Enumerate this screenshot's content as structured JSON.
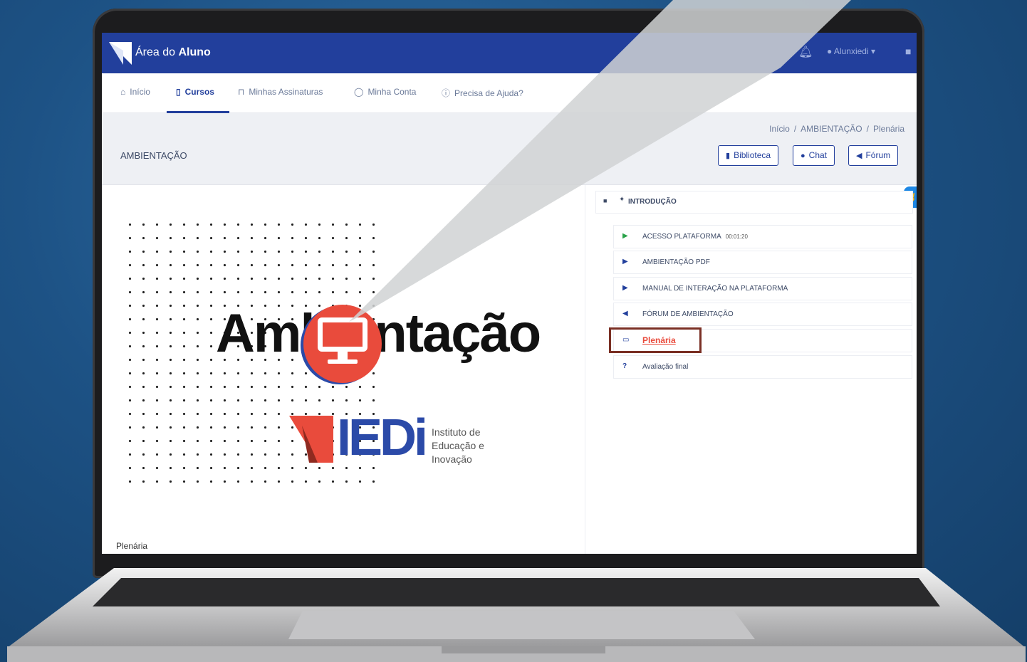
{
  "header": {
    "app_title_prefix": "Área do",
    "app_title_bold": "Aluno",
    "user_name": "Alunxiedi",
    "brand_color": "#223f9c"
  },
  "nav": {
    "items": [
      {
        "label": "Início",
        "icon": "home-icon"
      },
      {
        "label": "Cursos",
        "icon": "book-icon",
        "active": true
      },
      {
        "label": "Minhas Assinaturas",
        "icon": "cart-icon"
      },
      {
        "label": "Minha Conta",
        "icon": "user-icon"
      },
      {
        "label": "Precisa de Ajuda?",
        "icon": "help-icon"
      }
    ]
  },
  "breadcrumb": [
    "Início",
    "AMBIENTAÇÃO",
    "Plenária"
  ],
  "page": {
    "title": "AMBIENTAÇÃO",
    "buttons": [
      {
        "label": "Biblioteca",
        "icon": "book-icon"
      },
      {
        "label": "Chat",
        "icon": "chat-icon"
      },
      {
        "label": "Fórum",
        "icon": "megaphone-icon"
      }
    ]
  },
  "hero": {
    "heading": "Ambientação",
    "brand": "IEDi",
    "tagline_1": "Instituto de",
    "tagline_2": "Educação e",
    "tagline_3": "Inovação",
    "footer_label": "Plenária",
    "accent_color": "#e94b3c"
  },
  "module": {
    "title": "INTRODUÇÃO",
    "lessons": [
      {
        "label": "ACESSO PLATAFORMA",
        "duration": "00:01:20",
        "icon": "play-icon"
      },
      {
        "label": "AMBIENTAÇÃO PDF",
        "icon": "play-icon"
      },
      {
        "label": "MANUAL DE INTERAÇÃO NA PLATAFORMA",
        "icon": "play-icon"
      },
      {
        "label": "FÓRUM DE AMBIENTAÇÃO",
        "icon": "megaphone-icon"
      },
      {
        "label": "Plenária",
        "icon": "monitor-icon",
        "highlighted": true
      },
      {
        "label": "Avaliação final",
        "icon": "question-icon"
      }
    ]
  }
}
